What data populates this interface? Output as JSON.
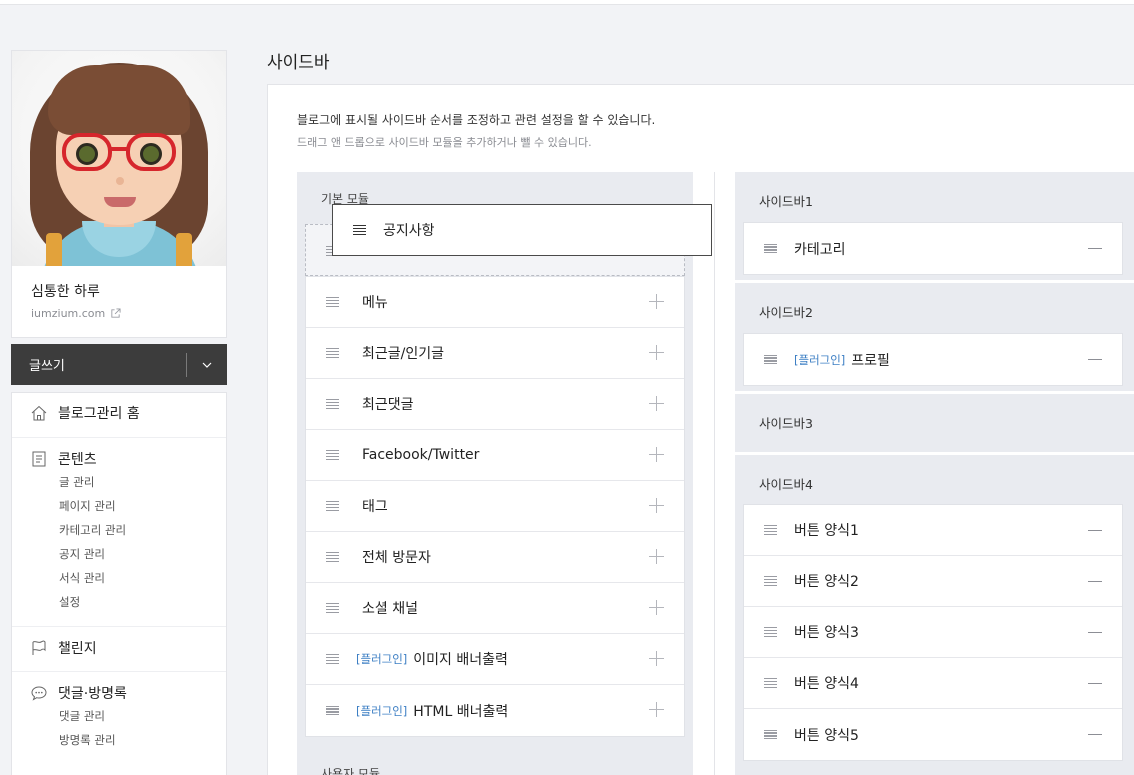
{
  "page": {
    "title": "사이드바"
  },
  "profile": {
    "name": "심통한 하루",
    "domain": "iumzium.com"
  },
  "write_button": {
    "label": "글쓰기"
  },
  "menu": {
    "home": "블로그관리 홈",
    "contents": {
      "label": "콘텐츠",
      "items": [
        "글 관리",
        "페이지 관리",
        "카테고리 관리",
        "공지 관리",
        "서식 관리",
        "설정"
      ]
    },
    "challenge": "챌린지",
    "comments": {
      "label": "댓글·방명록",
      "items": [
        "댓글 관리",
        "방명록 관리"
      ]
    }
  },
  "description": {
    "line1": "블로그에 표시될 사이드바 순서를 조정하고 관련 설정을 할 수 있습니다.",
    "line2": "드래그 앤 드롭으로 사이드바 모듈을 추가하거나 뺄 수 있습니다."
  },
  "basic_modules": {
    "title": "기본 모듈",
    "dragging_item": "공지사항",
    "items": [
      {
        "tag": "",
        "label": "메뉴"
      },
      {
        "tag": "",
        "label": "최근글/인기글"
      },
      {
        "tag": "",
        "label": "최근댓글"
      },
      {
        "tag": "",
        "label": "Facebook/Twitter"
      },
      {
        "tag": "",
        "label": "태그"
      },
      {
        "tag": "",
        "label": "전체 방문자"
      },
      {
        "tag": "",
        "label": "소셜 채널"
      },
      {
        "tag": "[플러그인]",
        "label": "이미지 배너출력"
      },
      {
        "tag": "[플러그인]",
        "label": "HTML 배너출력"
      }
    ]
  },
  "user_modules": {
    "title": "사용자 모듈"
  },
  "sidebars": [
    {
      "title": "사이드바1",
      "items": [
        {
          "tag": "",
          "label": "카테고리"
        }
      ]
    },
    {
      "title": "사이드바2",
      "items": [
        {
          "tag": "[플러그인]",
          "label": "프로필"
        }
      ]
    },
    {
      "title": "사이드바3",
      "items": []
    },
    {
      "title": "사이드바4",
      "items": [
        {
          "tag": "",
          "label": "버튼 양식1"
        },
        {
          "tag": "",
          "label": "버튼 양식2"
        },
        {
          "tag": "",
          "label": "버튼 양식3"
        },
        {
          "tag": "",
          "label": "버튼 양식4"
        },
        {
          "tag": "",
          "label": "버튼 양식5"
        }
      ]
    }
  ],
  "colors": {
    "plugin_tag": "#3d7fc4",
    "write_button_bg": "#3c3c3c",
    "module_bg": "#e9ebf0"
  }
}
